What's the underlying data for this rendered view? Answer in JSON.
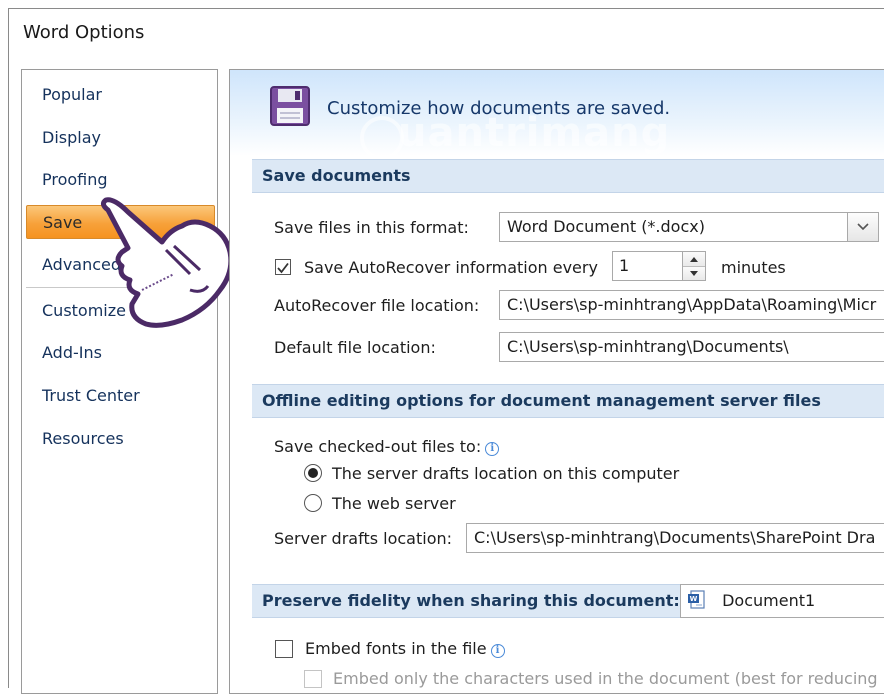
{
  "window": {
    "title": "Word Options"
  },
  "sidebar": {
    "items": [
      {
        "label": "Popular"
      },
      {
        "label": "Display"
      },
      {
        "label": "Proofing"
      },
      {
        "label": "Save"
      },
      {
        "label": "Advanced"
      },
      {
        "label": "Customize"
      },
      {
        "label": "Add-Ins"
      },
      {
        "label": "Trust Center"
      },
      {
        "label": "Resources"
      }
    ],
    "selected": "Save"
  },
  "banner": {
    "text": "Customize how documents are saved.",
    "watermark": "uantrimang"
  },
  "save_documents": {
    "header": "Save documents",
    "format_label": "Save files in this format:",
    "format_value": "Word Document (*.docx)",
    "autorecover_label": "Save AutoRecover information every",
    "autorecover_checked": true,
    "autorecover_value": "1",
    "minutes_label": "minutes",
    "autorecover_location_label": "AutoRecover file location:",
    "autorecover_location_value": "C:\\Users\\sp-minhtrang\\AppData\\Roaming\\Micr",
    "default_location_label": "Default file location:",
    "default_location_value": "C:\\Users\\sp-minhtrang\\Documents\\"
  },
  "offline": {
    "header": "Offline editing options for document management server files",
    "save_to_label": "Save checked-out files to:",
    "option_server_drafts": "The server drafts location on this computer",
    "option_web_server": "The web server",
    "selected_option": "server_drafts",
    "drafts_location_label": "Server drafts location:",
    "drafts_location_value": "C:\\Users\\sp-minhtrang\\Documents\\SharePoint Dra"
  },
  "fidelity": {
    "header": "Preserve fidelity when sharing this document:",
    "document_value": "Document1",
    "embed_fonts_label": "Embed fonts in the file",
    "embed_fonts_checked": false,
    "embed_chars_label": "Embed only the characters used in the document (best for reducing",
    "embed_chars_checked": false
  },
  "colors": {
    "accent": "#f7a13a",
    "section_bg": "#dce8f5",
    "nav_text": "#15325c"
  }
}
